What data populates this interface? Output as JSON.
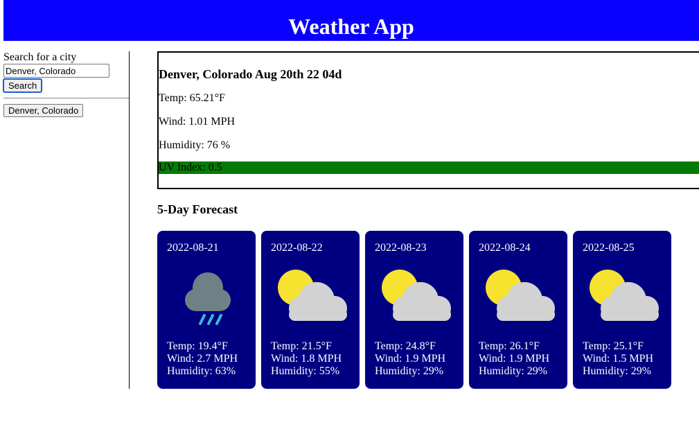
{
  "header": {
    "title": "Weather App"
  },
  "search": {
    "label": "Search for a city",
    "input_value": "Denver, Colorado",
    "button_label": "Search"
  },
  "history": [
    {
      "label": "Denver, Colorado"
    }
  ],
  "current": {
    "heading": "Denver, Colorado Aug 20th 22 04d",
    "temp": "Temp: 65.21°F",
    "wind": "Wind: 1.01 MPH",
    "humidity": "Humidity: 76 %",
    "uv": "UV Index: 0.5",
    "uv_color": "#067a06"
  },
  "forecast": {
    "title": "5-Day Forecast",
    "card_color": "#000080",
    "days": [
      {
        "date": "2022-08-21",
        "icon": "rain-cloud-icon",
        "temp": "Temp: 19.4°F",
        "wind": "Wind: 2.7 MPH",
        "humidity": "Humidity: 63%"
      },
      {
        "date": "2022-08-22",
        "icon": "partly-cloudy-icon",
        "temp": "Temp: 21.5°F",
        "wind": "Wind: 1.8 MPH",
        "humidity": "Humidity: 55%"
      },
      {
        "date": "2022-08-23",
        "icon": "partly-cloudy-icon",
        "temp": "Temp: 24.8°F",
        "wind": "Wind: 1.9 MPH",
        "humidity": "Humidity: 29%"
      },
      {
        "date": "2022-08-24",
        "icon": "partly-cloudy-icon",
        "temp": "Temp: 26.1°F",
        "wind": "Wind: 1.9 MPH",
        "humidity": "Humidity: 29%"
      },
      {
        "date": "2022-08-25",
        "icon": "partly-cloudy-icon",
        "temp": "Temp: 25.1°F",
        "wind": "Wind: 1.5 MPH",
        "humidity": "Humidity: 29%"
      }
    ]
  }
}
